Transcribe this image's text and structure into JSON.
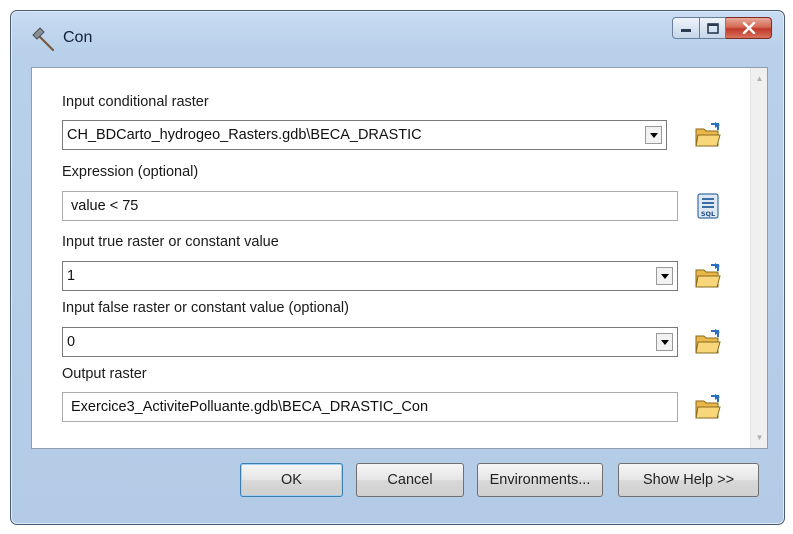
{
  "window": {
    "title": "Con",
    "icon": "hammer-icon"
  },
  "form": {
    "input_conditional_raster": {
      "label": "Input conditional raster",
      "value": "CH_BDCarto_hydrogeo_Rasters.gdb\\BECA_DRASTIC"
    },
    "expression": {
      "label": "Expression (optional)",
      "value": "value < 75",
      "button_icon": "sql-icon"
    },
    "input_true": {
      "label": "Input true raster or constant value",
      "value": "1"
    },
    "input_false": {
      "label": "Input false raster or constant value (optional)",
      "value": "0"
    },
    "output_raster": {
      "label": "Output raster",
      "value": "Exercice3_ActivitePolluante.gdb\\BECA_DRASTIC_Con"
    }
  },
  "buttons": {
    "ok": "OK",
    "cancel": "Cancel",
    "environments": "Environments...",
    "show_help": "Show Help >>"
  },
  "colors": {
    "window_frame": "#b9d0ea",
    "close_button": "#c0392b",
    "default_button_border": "#3c7fb1"
  }
}
